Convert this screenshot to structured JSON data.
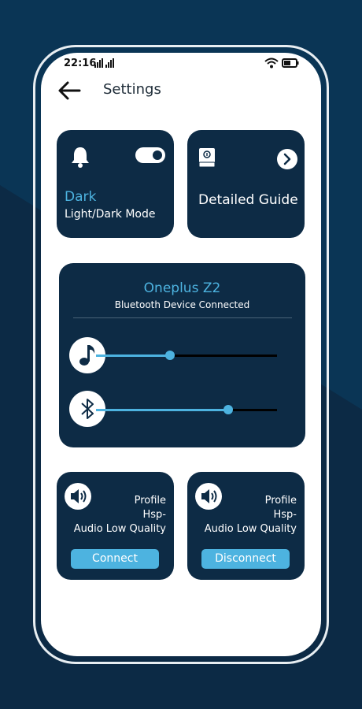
{
  "status_bar": {
    "time": "22:16"
  },
  "header": {
    "title": "Settings"
  },
  "mode_card": {
    "value": "Dark",
    "label": "Light/Dark Mode"
  },
  "guide_card": {
    "title": "Detailed Guide"
  },
  "bluetooth_card": {
    "device_name": "Oneplus Z2",
    "status": "Bluetooth Device Connected",
    "music_volume": 0.41,
    "bluetooth_volume": 0.73
  },
  "profile_cards": [
    {
      "line1": "Profile",
      "line2": "Hsp-",
      "line3": "Audio Low Quality",
      "button": "Connect"
    },
    {
      "line1": "Profile",
      "line2": "Hsp-",
      "line3": "Audio Low Quality",
      "button": "Disconnect"
    }
  ],
  "colors": {
    "card": "#0d2b45",
    "accent": "#4db3e0",
    "background": "#0a3050"
  },
  "icons": [
    "back-arrow-icon",
    "bell-icon",
    "book-icon",
    "chevron-right-icon",
    "music-note-icon",
    "bluetooth-icon",
    "speaker-icon",
    "wifi-icon",
    "battery-icon",
    "signal-icon"
  ]
}
